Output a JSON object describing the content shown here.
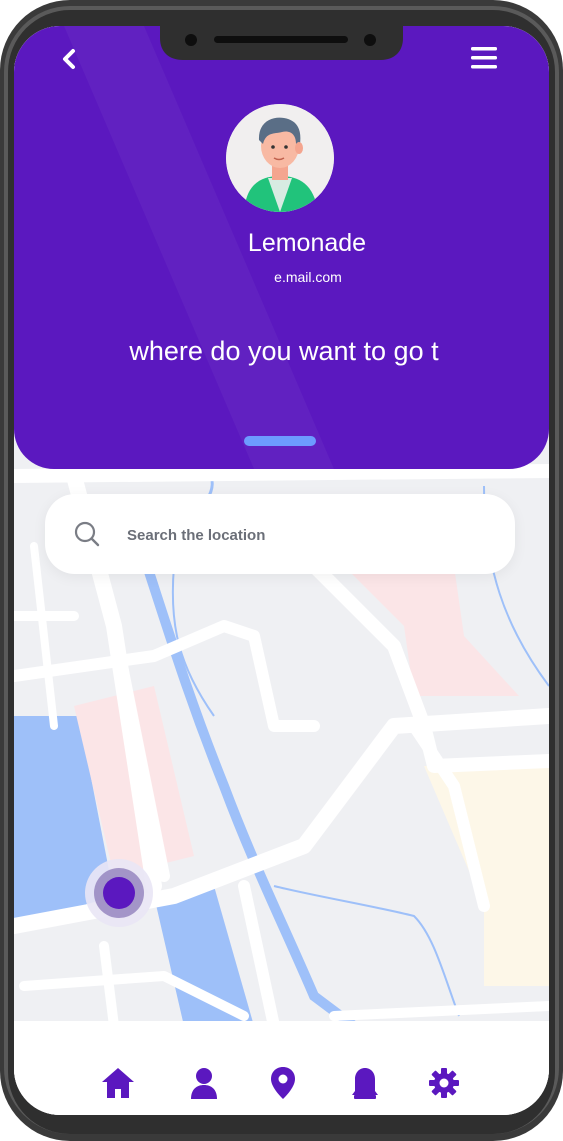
{
  "profile": {
    "name": "Lemonade",
    "email": "e.mail.com",
    "avatar_icon": "user-avatar-illustration"
  },
  "header": {
    "prompt": "where do you want to go t",
    "background_color": "#5b18bf",
    "back_icon": "chevron-left-icon",
    "menu_icon": "hamburger-menu-icon",
    "handle_color": "#6d9bff"
  },
  "search": {
    "placeholder": "Search the location",
    "icon": "search-icon"
  },
  "map": {
    "pin_color": "#5b18bf",
    "water_color": "#9ec0f9",
    "road_color": "#ffffff",
    "land_color": "#eff0f3"
  },
  "bottom_nav": {
    "items": [
      {
        "icon": "home-icon"
      },
      {
        "icon": "user-icon"
      },
      {
        "icon": "location-pin-icon"
      },
      {
        "icon": "bell-icon"
      },
      {
        "icon": "gear-icon"
      }
    ],
    "icon_color": "#5b18bf"
  }
}
